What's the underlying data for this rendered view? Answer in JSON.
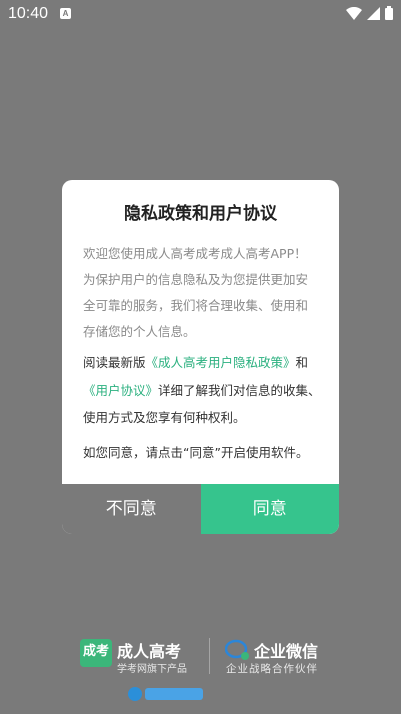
{
  "status_bar": {
    "time": "10:40",
    "notification_icon": "A",
    "icons": [
      "wifi-icon",
      "signal-icon",
      "battery-icon"
    ]
  },
  "dialog": {
    "title": "隐私政策和用户协议",
    "intro": "欢迎您使用成人高考成考成人高考APP！为保护用户的信息隐私及为您提供更加安全可靠的服务，我们将合理收集、使用和存储您的个人信息。",
    "policy_prefix": "阅读最新版",
    "privacy_link": "《成人高考用户隐私政策》",
    "policy_and": "和",
    "user_agreement_link": "《用户协议》",
    "policy_suffix": "详细了解我们对信息的收集、使用方式及您享有何种权利。",
    "consent": "如您同意，请点击“同意”开启使用软件。",
    "disagree_label": "不同意",
    "agree_label": "同意"
  },
  "footer": {
    "brand_a_logo_text": "成考",
    "brand_a_name": "成人高考",
    "brand_a_sub": "学考网旗下产品",
    "brand_b_name": "企业微信",
    "brand_b_sub": "企业战略合作伙伴"
  },
  "colors": {
    "overlay": "#7a7a7a",
    "accent": "#36c48d",
    "link": "#2bb07f"
  }
}
